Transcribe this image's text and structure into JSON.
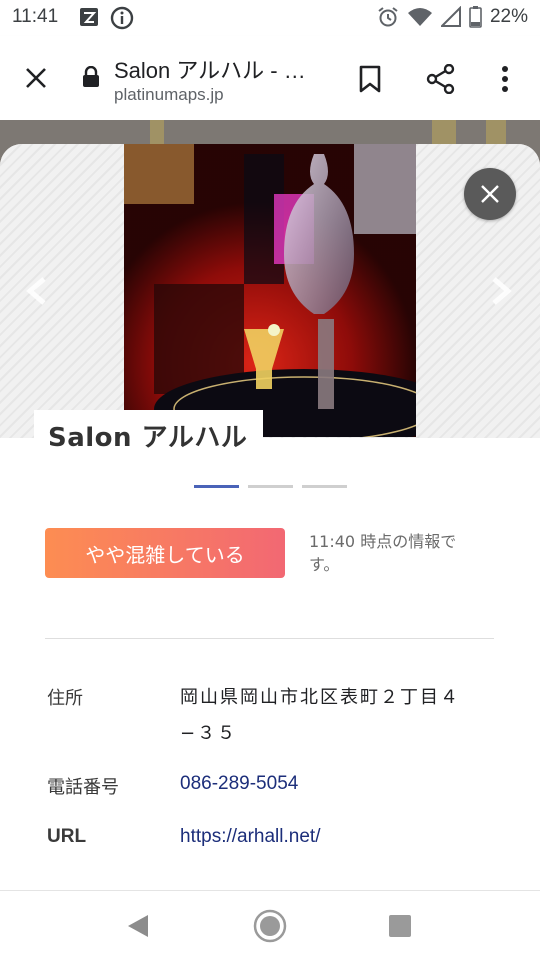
{
  "status": {
    "time": "11:41",
    "battery": "22%"
  },
  "browser": {
    "title": "Salon アルハル - …",
    "url": "platinumaps.jp"
  },
  "venue": {
    "name": "Salon アルハル",
    "photo_count": 3,
    "active_photo": 1
  },
  "crowd": {
    "status": "やや混雑している",
    "time_note": "11:40 時点の情報です。"
  },
  "details": {
    "address_label": "住所",
    "address_line1": "岡山県岡山市北区表町２丁目４",
    "address_line2": "−３５",
    "phone_label": "電話番号",
    "phone": "086-289-5054",
    "url_label": "URL",
    "url": "https://arhall.net/"
  },
  "colors": {
    "crowd_gradient_start": "#fd8d52",
    "crowd_gradient_end": "#f26873",
    "indicator_active": "#4a63b8",
    "link": "#1c2e7a"
  },
  "icons": {
    "status_left": [
      "notification-icon",
      "info-icon"
    ],
    "status_right": [
      "alarm-icon",
      "wifi-icon",
      "signal-icon",
      "battery-icon"
    ],
    "browser": [
      "close-icon",
      "lock-icon",
      "bookmark-icon",
      "share-icon",
      "more-vert-icon"
    ],
    "nav": [
      "back-icon",
      "home-icon",
      "recents-icon"
    ]
  }
}
